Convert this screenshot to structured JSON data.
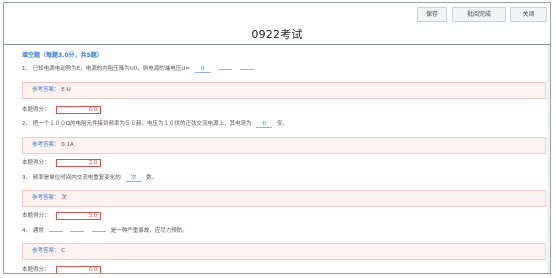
{
  "toolbar": {
    "save_label": "保存",
    "batch_label": "批阅完成",
    "close_label": "关闭"
  },
  "exam": {
    "title": "0922考试"
  },
  "section": {
    "header": "填空题（每题3.0分，共5题）"
  },
  "questions": [
    {
      "number": "1、",
      "text_before": "已知电源电动势为E，电源的内阻压降为U0，则电源的端电压U=",
      "blanks": [
        "0",
        "",
        ""
      ],
      "text_after": "",
      "answer_label": "参考答案：",
      "answer": "E-U",
      "score_label": "本题得分：",
      "score": "0.0"
    },
    {
      "number": "2、",
      "text_before": "把一个１００Ω的电阻元件接到频率为５０赫，电压为１０伏的正弦交流电源上，其电流为",
      "blanks": [
        "0"
      ],
      "text_after": "安。",
      "answer_label": "参考答案：",
      "answer": "0.1A",
      "score_label": "本题得分：",
      "score": "3.0"
    },
    {
      "number": "3、",
      "text_before": "频率是单位时间内交流电重复变化的",
      "blanks": [
        "次"
      ],
      "text_after": "数。",
      "answer_label": "参考答案：",
      "answer": "次",
      "score_label": "本题得分：",
      "score": "3.0"
    },
    {
      "number": "4、",
      "text_before": "通常",
      "blanks": [
        "",
        "",
        ""
      ],
      "text_after": "是一种严重事故，应尽力预防。",
      "answer_label": "参考答案：",
      "answer": "C",
      "score_label": "本题得分：",
      "score": "0.0"
    }
  ]
}
